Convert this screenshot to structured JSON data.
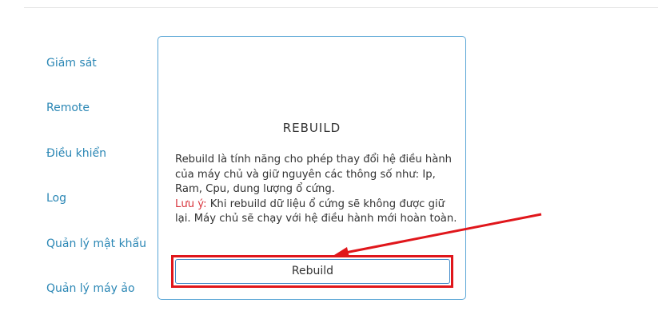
{
  "sidebar": {
    "items": [
      {
        "label": "Giám sát"
      },
      {
        "label": "Remote"
      },
      {
        "label": "Điều khiển"
      },
      {
        "label": "Log"
      },
      {
        "label": "Quản lý mật khẩu"
      },
      {
        "label": "Quản lý máy ảo"
      }
    ]
  },
  "card": {
    "title": "REBUILD",
    "description": "Rebuild là tính năng cho phép thay đổi hệ điều hành của máy chủ và giữ nguyên các thông số như: Ip, Ram, Cpu, dung lượng ổ cứng.",
    "note_label": "Lưu ý:",
    "note_text": " Khi rebuild dữ liệu ổ cứng sẽ không được giữ lại. Máy chủ sẽ chạy với hệ điều hành mới hoàn toàn.",
    "button_label": "Rebuild"
  },
  "colors": {
    "accent": "#2b87b5",
    "border": "#5aa6d6",
    "highlight": "#e0161b",
    "note": "#d9363e"
  }
}
